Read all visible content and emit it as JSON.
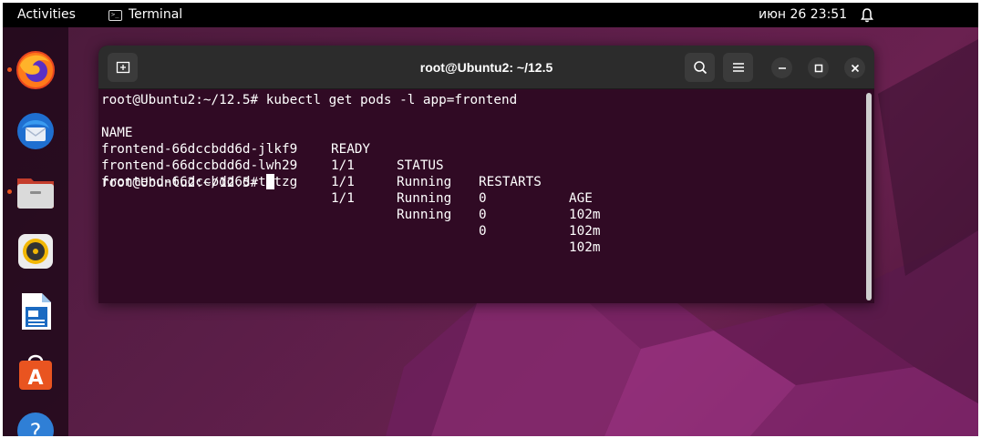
{
  "topbar": {
    "activities": "Activities",
    "app_name": "Terminal",
    "app_icon_glyph": ">_",
    "clock": "июн 26  23:51",
    "bell_icon": "bell-icon"
  },
  "dock": {
    "items": [
      {
        "name": "firefox",
        "running": true
      },
      {
        "name": "thunderbird",
        "running": false
      },
      {
        "name": "files",
        "running": true
      },
      {
        "name": "rhythmbox",
        "running": false
      },
      {
        "name": "libreoffice-writer",
        "running": false
      },
      {
        "name": "ubuntu-software",
        "running": false
      },
      {
        "name": "help",
        "running": false
      }
    ],
    "help_glyph": "?",
    "software_glyph": "A"
  },
  "window": {
    "title": "root@Ubuntu2: ~/12.5",
    "new_tab_glyph": "+",
    "menu_glyph": "≡",
    "minimize_glyph": "–",
    "maximize_glyph": "□",
    "close_glyph": "×"
  },
  "terminal": {
    "prompt": "root@Ubuntu2:~/12.5#",
    "command": "kubectl get pods -l app=frontend",
    "headers": [
      "NAME",
      "READY",
      "STATUS",
      "RESTARTS",
      "AGE"
    ],
    "rows": [
      [
        "frontend-66dccbdd6d-jlkf9",
        "1/1",
        "Running",
        "0",
        "102m"
      ],
      [
        "frontend-66dccbdd6d-lwh29",
        "1/1",
        "Running",
        "0",
        "102m"
      ],
      [
        "frontend-66dccbdd6d-tktzg",
        "1/1",
        "Running",
        "0",
        "102m"
      ]
    ],
    "final_prompt": "root@Ubuntu2:~/12.5#"
  },
  "colors": {
    "terminal_bg": "#300a24",
    "accent": "#e95420",
    "topbar_bg": "#000000"
  }
}
